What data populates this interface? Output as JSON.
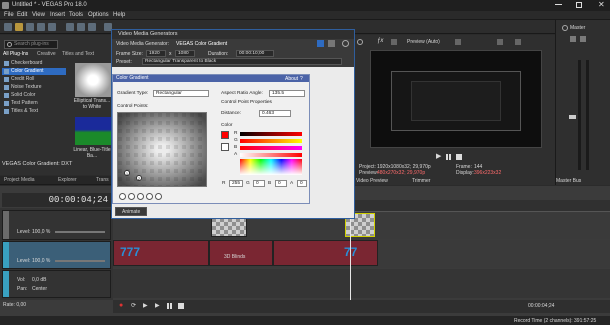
{
  "window": {
    "title": "Untitled * - VEGAS Pro 18.0"
  },
  "menu": [
    "File",
    "Edit",
    "View",
    "Insert",
    "Tools",
    "Options",
    "Help"
  ],
  "left_panel": {
    "search_placeholder": "Search plug-ins",
    "tabs": [
      "All Plug-Ins",
      "Creative",
      "Titles and Text"
    ],
    "items": [
      "Checkerboard",
      "Color Gradient",
      "Credit Roll",
      "Noise Texture",
      "Solid Color",
      "Test Pattern",
      "Titles & Text"
    ],
    "selected_index": 1,
    "thumbs": [
      "Elliptical Trans... to White",
      "Linear, Blue-Title Ba..."
    ],
    "preset_name": "VEGAS Color Gradient: DXT"
  },
  "bottom_tabs": [
    "Project Media",
    "Explorer",
    "Trans"
  ],
  "dialog": {
    "title": "Video Media Generators",
    "subtitle_label": "Video Media Generator:",
    "subtitle_value": "VEGAS Color Gradient",
    "frame_size_label": "Frame Size:",
    "frame_w": "1920",
    "x": "x",
    "frame_h": "1080",
    "duration_label": "Duration:",
    "duration_value": "00:00:10;00",
    "preset_label": "Preset:",
    "preset_value": "Rectangular Transparent to Black"
  },
  "gradient": {
    "title": "Color Gradient",
    "about": "About",
    "help": "?",
    "gradient_type_label": "Gradient Type:",
    "gradient_type_value": "Rectangular",
    "aspect_label": "Aspect Ratio Angle:",
    "aspect_value": "135.5",
    "control_points_label": "Control Points:",
    "cpp_label": "Control Point Properties",
    "distance_label": "Distance:",
    "distance_value": "0.463",
    "color_label": "Color",
    "rgba": {
      "r_label": "R",
      "r": "255",
      "g_label": "G",
      "g": "0",
      "b_label": "B",
      "b": "0",
      "a_label": "A",
      "a": "0"
    },
    "rgb_channels": [
      "R",
      "G",
      "B",
      "A"
    ],
    "point_markers": [
      "1",
      "2"
    ],
    "animate": "Animate"
  },
  "preview": {
    "mode": "Preview (Auto)",
    "project_label": "Project:",
    "project_value": "1920x1080x32; 29,970p",
    "preview_label": "Preview:",
    "preview_value": "480x270x32; 29,970p",
    "display_label": "Display:",
    "display_value": "396x223x32",
    "frame_label": "Frame:",
    "frame_value": "144",
    "tabs": [
      "Video Preview",
      "Trimmer"
    ],
    "master_bus": "Master Bus"
  },
  "master": {
    "label": "Master"
  },
  "timeline": {
    "time": "00:00:04;24",
    "end_time": "00:00:04;24",
    "tracks": [
      {
        "level_label": "Level:",
        "level_value": "100,0 %"
      },
      {
        "level_label": "Level:",
        "level_value": "100,0 %"
      },
      {
        "vol_label": "Vol:",
        "vol_value": "0,0 dB",
        "pan_label": "Pan:",
        "pan_value": "Center"
      }
    ],
    "clip_label": "3D Blinds",
    "rate_label": "Rate: 0,00"
  },
  "status": {
    "record_time": "Record Time (2 channels): 391:57:25"
  },
  "colors": {
    "accent": "#2e6bc1",
    "dialog_title": "#4b63a7",
    "clip_red": "#7a2632",
    "track_blue": "#3b5f78"
  }
}
